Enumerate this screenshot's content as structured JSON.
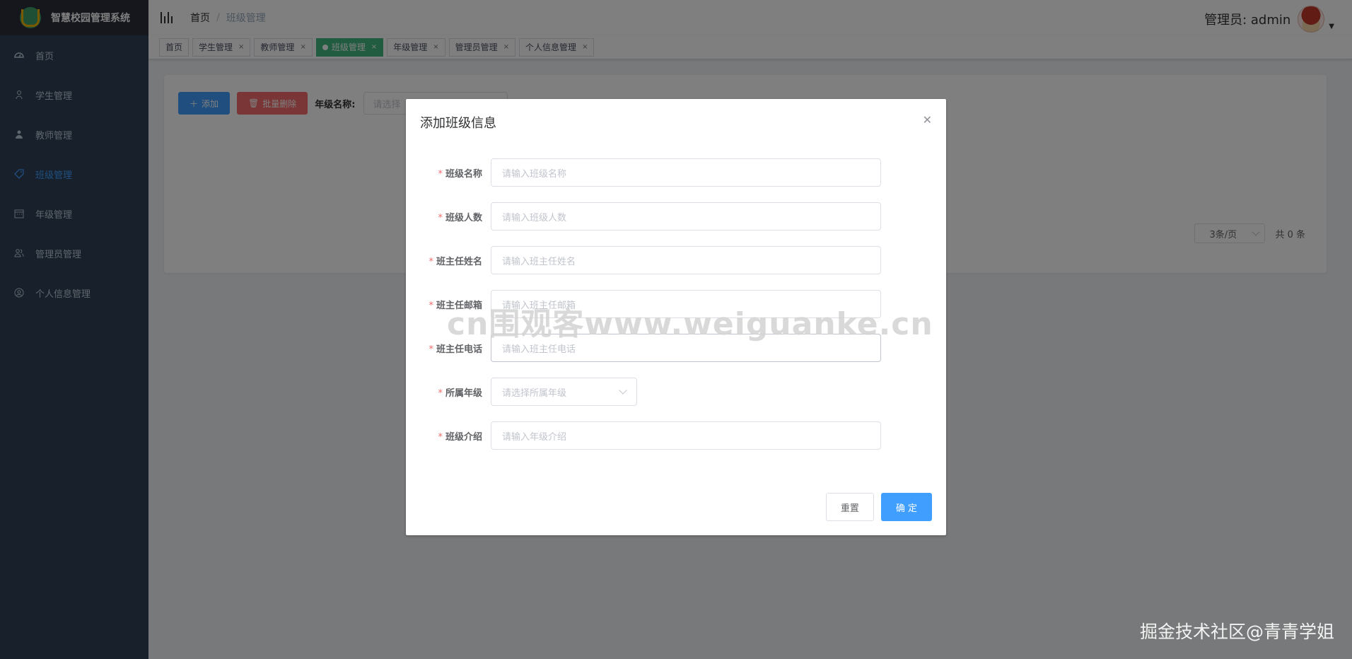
{
  "app": {
    "title": "智慧校园管理系统"
  },
  "sidebar": {
    "items": [
      {
        "label": "首页",
        "icon": "dashboard-icon",
        "active": false
      },
      {
        "label": "学生管理",
        "icon": "user-icon",
        "active": false
      },
      {
        "label": "教师管理",
        "icon": "people-icon",
        "active": false
      },
      {
        "label": "班级管理",
        "icon": "tag-icon",
        "active": true
      },
      {
        "label": "年级管理",
        "icon": "calendar-icon",
        "active": false
      },
      {
        "label": "管理员管理",
        "icon": "peoples-icon",
        "active": false
      },
      {
        "label": "个人信息管理",
        "icon": "user-circle-icon",
        "active": false
      }
    ]
  },
  "header": {
    "breadcrumb": {
      "home": "首页",
      "separator": "/",
      "current": "班级管理"
    },
    "user_label": "管理员: admin"
  },
  "tags": [
    {
      "label": "首页",
      "closable": false,
      "active": false
    },
    {
      "label": "学生管理",
      "closable": true,
      "active": false
    },
    {
      "label": "教师管理",
      "closable": true,
      "active": false
    },
    {
      "label": "班级管理",
      "closable": true,
      "active": true
    },
    {
      "label": "年级管理",
      "closable": true,
      "active": false
    },
    {
      "label": "管理员管理",
      "closable": true,
      "active": false
    },
    {
      "label": "个人信息管理",
      "closable": true,
      "active": false
    }
  ],
  "tag_close_glyph": "×",
  "toolbar": {
    "add_label": "添加",
    "batch_delete_label": "批量删除",
    "grade_filter_label": "年级名称:",
    "grade_filter_placeholder": "请选择"
  },
  "pager": {
    "page_size": "3条/页",
    "total": "共 0 条"
  },
  "dialog": {
    "title": "添加班级信息",
    "fields": [
      {
        "label": "班级名称",
        "placeholder": "请输入班级名称",
        "type": "input"
      },
      {
        "label": "班级人数",
        "placeholder": "请输入班级人数",
        "type": "input"
      },
      {
        "label": "班主任姓名",
        "placeholder": "请输入班主任姓名",
        "type": "input"
      },
      {
        "label": "班主任邮箱",
        "placeholder": "请输入班主任邮箱",
        "type": "input"
      },
      {
        "label": "班主任电话",
        "placeholder": "请输入班主任电话",
        "type": "input"
      },
      {
        "label": "所属年级",
        "placeholder": "请选择所属年级",
        "type": "select"
      },
      {
        "label": "班级介绍",
        "placeholder": "请输入年级介绍",
        "type": "input"
      }
    ],
    "required_mark": "*",
    "reset_label": "重置",
    "confirm_label": "确 定"
  },
  "watermarks": {
    "center": "cn围观客www.weiguanke.cn",
    "corner": "掘金技术社区@青青学姐"
  },
  "colors": {
    "sidebar_bg": "#304156",
    "primary": "#409eff",
    "active_tag": "#42b983",
    "danger": "#f56c6c"
  }
}
